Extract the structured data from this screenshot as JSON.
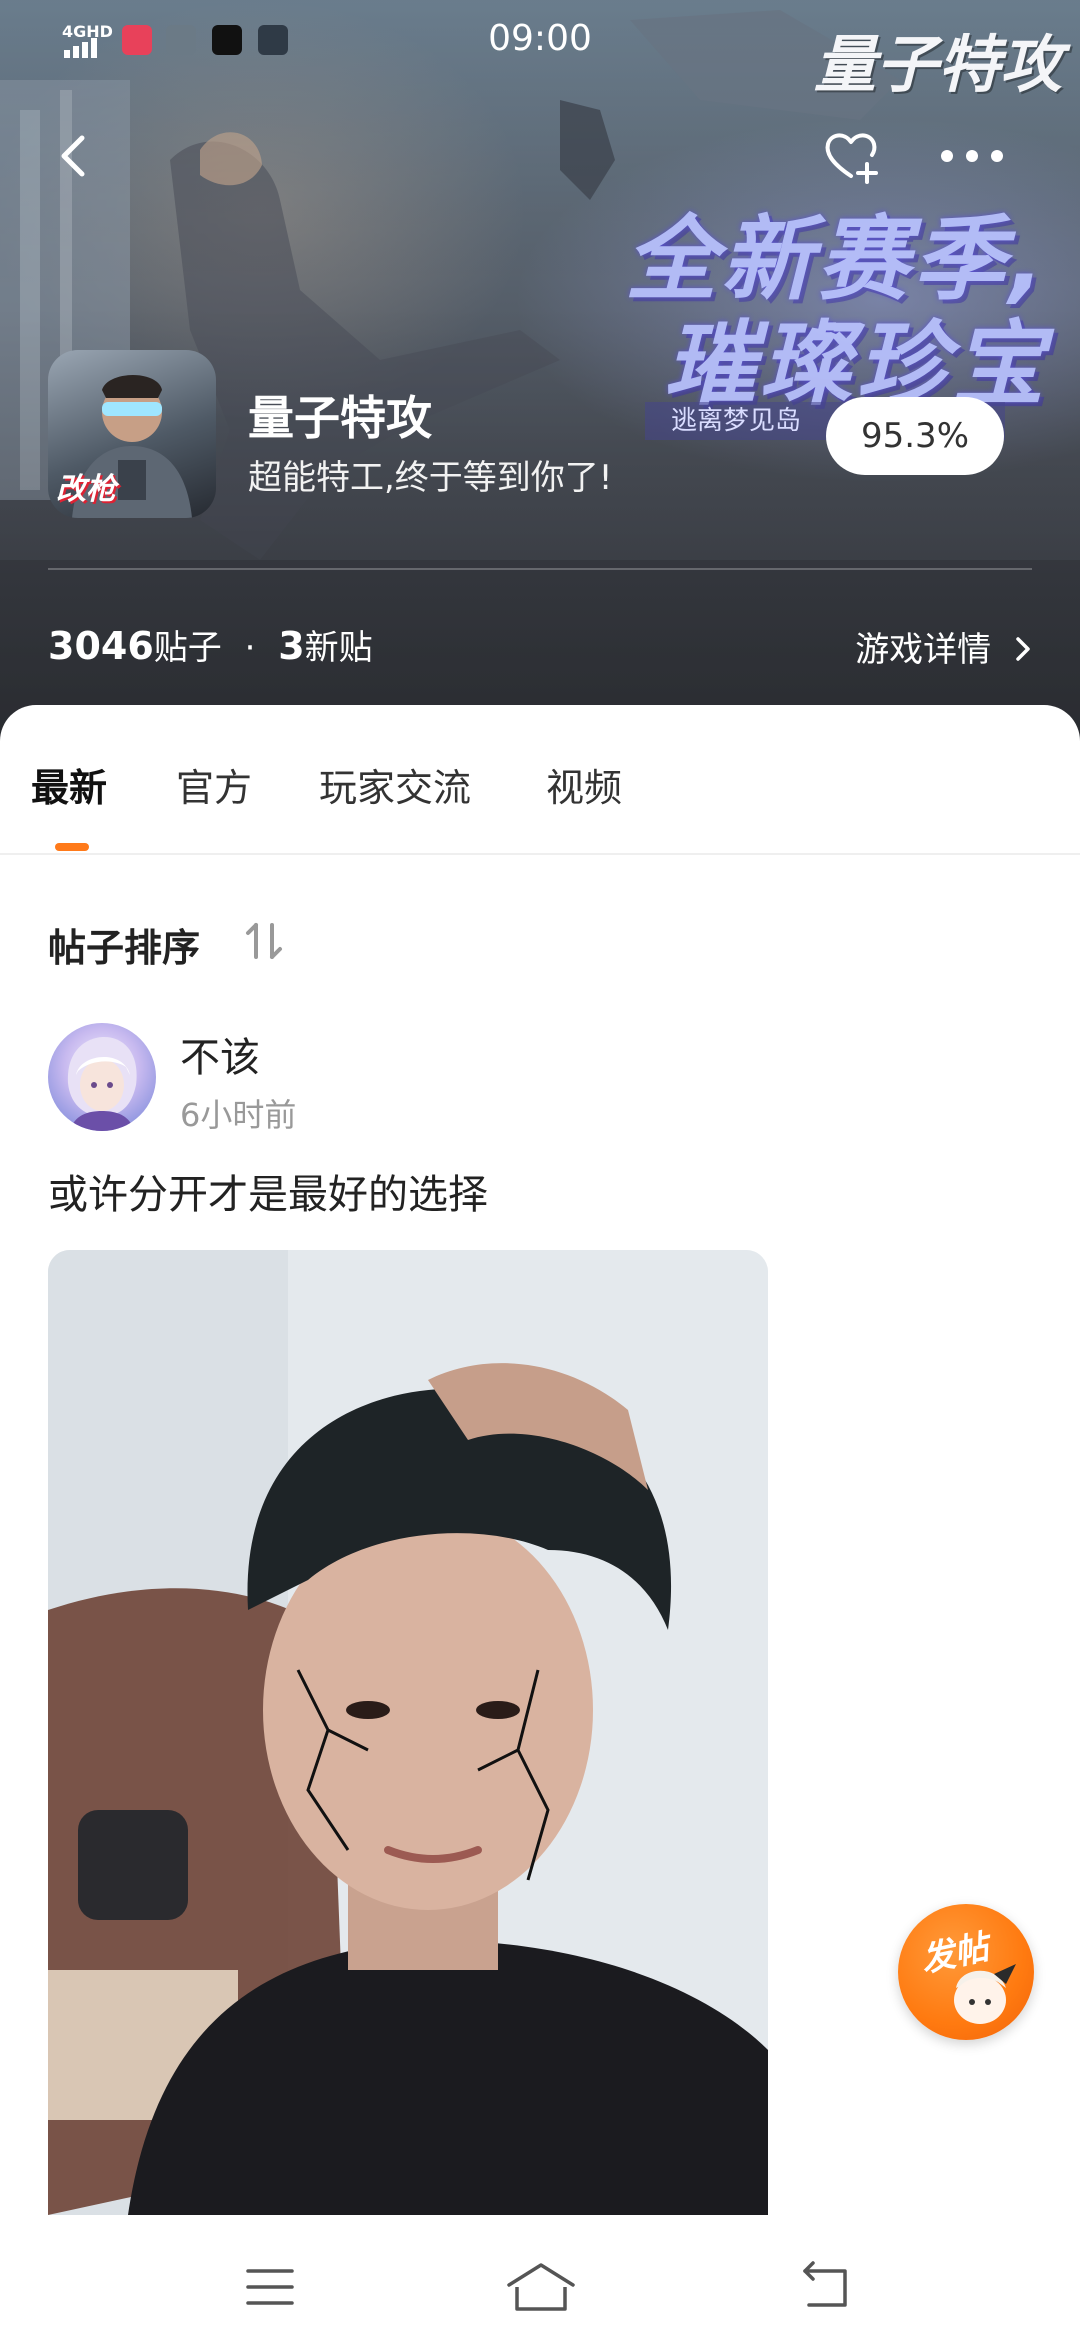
{
  "status_bar": {
    "network": "4GHD",
    "time": "09:00"
  },
  "header": {
    "brand_logo": "量子特攻",
    "banner_line1": "全新赛季,",
    "banner_line2": "璀璨珍宝",
    "banner_sub": "逃离梦见岛",
    "back_icon": "chevron-left-icon",
    "favorite_icon": "heart-plus-icon",
    "more_icon": "more-dots-icon"
  },
  "game": {
    "icon_tag": "改枪",
    "title": "量子特攻",
    "slogan": "超能特工,终于等到你了!",
    "rating": "95.3%",
    "posts_count": "3046",
    "posts_label": "贴子",
    "separator": "·",
    "new_count": "3",
    "new_label": "新贴",
    "details_label": "游戏详情"
  },
  "tabs": [
    {
      "label": "最新",
      "active": true
    },
    {
      "label": "官方",
      "active": false
    },
    {
      "label": "玩家交流",
      "active": false
    },
    {
      "label": "视频",
      "active": false
    }
  ],
  "sort": {
    "label": "帖子排序",
    "icon": "sort-arrows-icon"
  },
  "post": {
    "author": "不该",
    "time": "6小时前",
    "text": "或许分开才是最好的选择"
  },
  "fab": {
    "label": "发帖"
  },
  "nav": {
    "menu_icon": "menu-icon",
    "home_icon": "home-icon",
    "back_icon": "back-icon"
  },
  "colors": {
    "accent": "#ff7a1a",
    "text_primary": "#222222",
    "text_secondary": "#999999"
  }
}
